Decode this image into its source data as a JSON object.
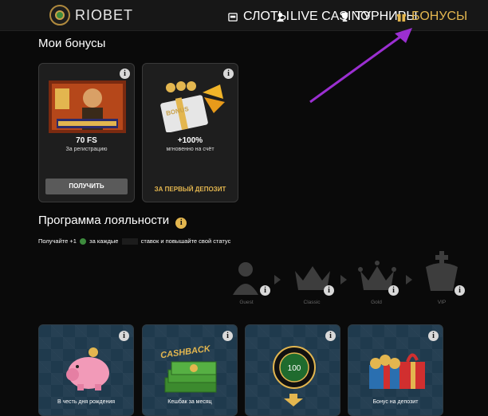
{
  "header": {
    "logo_text": "RIOBET",
    "nav": [
      {
        "label": "СЛОТЫ",
        "icon": "slot-machine-icon"
      },
      {
        "label": "LIVE CASINO",
        "icon": "live-dealer-icon"
      },
      {
        "label": "ТУРНИРЫ",
        "icon": "trophy-icon"
      },
      {
        "label": "БОНУСЫ",
        "icon": "gift-icon",
        "active": true
      }
    ],
    "active_color": "#e3b64f"
  },
  "my_bonuses": {
    "title": "Мои бонусы",
    "cards": [
      {
        "value": "70 FS",
        "subtitle": "За регистрацию",
        "button": "ПОЛУЧИТЬ",
        "image": "book-of-dead-game-thumbnail"
      },
      {
        "value": "+100%",
        "subtitle": "мгновенно на счёт",
        "footer": "ЗА ПЕРВЫЙ ДЕПОЗИТ",
        "image": "100-percent-bonus-gift-box",
        "image_text": "BONUS"
      }
    ]
  },
  "loyalty": {
    "title": "Программа лояльности",
    "description_pre": "Получайте +1",
    "description_mid": "за каждые",
    "description_post": "ставок и повышайте свой статус",
    "levels": [
      {
        "name": "Guest",
        "icon": "guest-person-icon"
      },
      {
        "name": "Classic",
        "icon": "classic-crown-icon"
      },
      {
        "name": "Gold",
        "icon": "gold-crown-icon"
      },
      {
        "name": "VIP",
        "icon": "vip-king-icon"
      }
    ]
  },
  "promo_cards": [
    {
      "label": "В честь дня рождения",
      "icon": "piggy-bank-icon"
    },
    {
      "label": "Кешбак за месяц",
      "icon": "cashback-money-icon",
      "image_text": "CASHBACK"
    },
    {
      "label": "",
      "icon": "coin-wheel-icon",
      "coin_value": "100"
    },
    {
      "label": "Бонус на депозит",
      "icon": "treasure-gift-icon"
    }
  ],
  "info_glyph": "i"
}
